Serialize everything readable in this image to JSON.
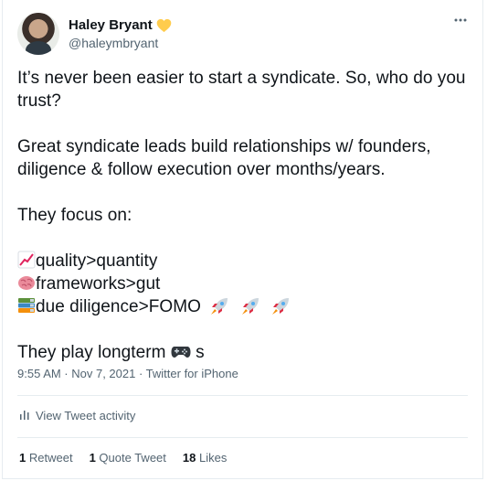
{
  "author": {
    "display_name": "Haley Bryant",
    "handle": "@haleymbryant",
    "badge_icon": "yellow-heart-icon"
  },
  "menu_icon": "more-horizontal-icon",
  "tweet": {
    "paragraph_1": "It’s never been easier to start a syndicate. So, who do you trust?",
    "paragraph_2": "Great syndicate leads build relationships w/ founders, diligence & follow execution over months/years.",
    "paragraph_3": "They focus on:",
    "list": [
      {
        "icon": "chart-increasing-icon",
        "text": "quality>quantity"
      },
      {
        "icon": "brain-icon",
        "text": "frameworks>gut"
      },
      {
        "icon": "books-icon",
        "text": "due diligence>FOMO",
        "trailing_icons": [
          "rocket-icon",
          "rocket-icon",
          "rocket-icon"
        ]
      }
    ],
    "closing_text": "They play longterm",
    "closing_icon": "video-game-controller-icon",
    "closing_suffix": " s"
  },
  "meta": {
    "timestamp": "9:55 AM · Nov 7, 2021 · Twitter for iPhone"
  },
  "activity": {
    "icon": "bar-chart-icon",
    "label": "View Tweet activity"
  },
  "stats": {
    "retweets_count": "1",
    "retweets_label": "Retweet",
    "quote_count": "1",
    "quote_label": "Quote Tweet",
    "likes_count": "18",
    "likes_label": "Likes"
  },
  "colors": {
    "text_primary": "#0f1419",
    "text_secondary": "#536471",
    "divider": "#e6ecf0",
    "heart": "#ffcc4d"
  }
}
